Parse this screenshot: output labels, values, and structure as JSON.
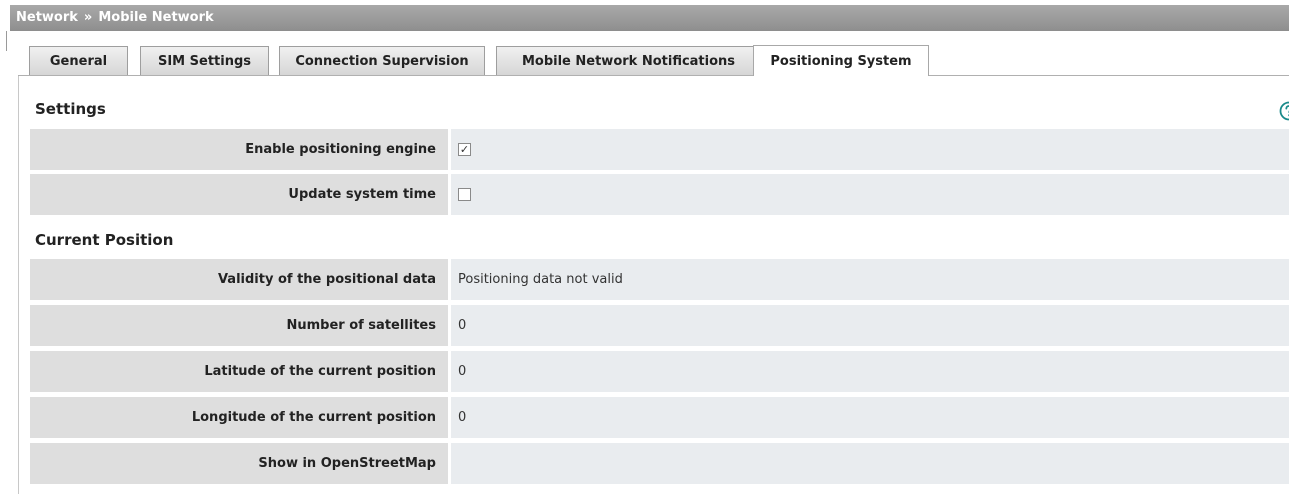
{
  "breadcrumb": {
    "parent": "Network",
    "separator": "»",
    "current": "Mobile Network"
  },
  "tabs": [
    {
      "label": "General",
      "active": false
    },
    {
      "label": "SIM Settings",
      "active": false
    },
    {
      "label": "Connection Supervision",
      "active": false
    },
    {
      "label": "Mobile Network Notifications",
      "active": false
    },
    {
      "label": "Positioning System",
      "active": true
    }
  ],
  "settings": {
    "title": "Settings",
    "help_icon": "question-circle-icon",
    "rows": [
      {
        "label": "Enable positioning engine",
        "checked": true
      },
      {
        "label": "Update system time",
        "checked": false
      }
    ]
  },
  "current_position": {
    "title": "Current Position",
    "rows": [
      {
        "label": "Validity of the positional data",
        "value": "Positioning data not valid"
      },
      {
        "label": "Number of satellites",
        "value": "0"
      },
      {
        "label": "Latitude of the current position",
        "value": "0"
      },
      {
        "label": "Longitude of the current position",
        "value": "0"
      },
      {
        "label": "Show in OpenStreetMap",
        "value": ""
      }
    ]
  },
  "colors": {
    "accent": "#1a8a8a",
    "header_bg": "#9a9a9a",
    "label_bg": "#dedede",
    "value_bg": "#e9ecef"
  }
}
